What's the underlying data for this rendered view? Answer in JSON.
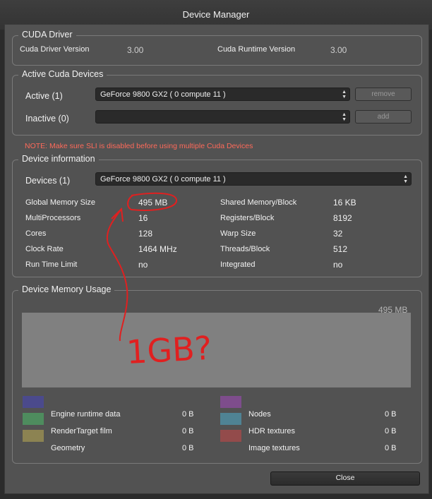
{
  "window": {
    "title": "Device Manager"
  },
  "cuda_driver": {
    "legend": "CUDA Driver",
    "driver_label": "Cuda Driver Version",
    "driver_value": "3.00",
    "runtime_label": "Cuda Runtime Version",
    "runtime_value": "3.00"
  },
  "active_devices": {
    "legend": "Active Cuda Devices",
    "active_label": "Active (1)",
    "active_value": "GeForce 9800 GX2 ( 0 compute 11 )",
    "remove_label": "remove",
    "inactive_label": "Inactive (0)",
    "inactive_value": "",
    "add_label": "add"
  },
  "note": "NOTE: Make sure SLI is disabled before using multiple Cuda Devices",
  "device_info": {
    "legend": "Device information",
    "devices_label": "Devices (1)",
    "devices_value": "GeForce 9800 GX2 ( 0 compute 11 )",
    "left": [
      {
        "label": "Global Memory Size",
        "value": "495 MB"
      },
      {
        "label": "MultiProcessors",
        "value": "16"
      },
      {
        "label": "Cores",
        "value": "128"
      },
      {
        "label": "Clock Rate",
        "value": "1464 MHz"
      },
      {
        "label": "Run Time Limit",
        "value": "no"
      }
    ],
    "right": [
      {
        "label": "Shared Memory/Block",
        "value": "16 KB"
      },
      {
        "label": "Registers/Block",
        "value": "8192"
      },
      {
        "label": "Warp Size",
        "value": "32"
      },
      {
        "label": "Threads/Block",
        "value": "512"
      },
      {
        "label": "Integrated",
        "value": "no"
      }
    ]
  },
  "memory_usage": {
    "legend": "Device Memory Usage",
    "total": "495 MB",
    "items_left": [
      {
        "label": "Engine runtime data",
        "value": "0 B",
        "color": "#4b4a8c"
      },
      {
        "label": "RenderTarget film",
        "value": "0 B",
        "color": "#4e8c5e"
      },
      {
        "label": "Geometry",
        "value": "0 B",
        "color": "#8c8352"
      }
    ],
    "items_right": [
      {
        "label": "Nodes",
        "value": "0 B",
        "color": "#7e4d8c"
      },
      {
        "label": "HDR textures",
        "value": "0 B",
        "color": "#4f8394"
      },
      {
        "label": "Image textures",
        "value": "0 B",
        "color": "#934b4b"
      }
    ]
  },
  "annotation": {
    "text": "1GB?",
    "color": "#e02020"
  },
  "close_label": "Close"
}
